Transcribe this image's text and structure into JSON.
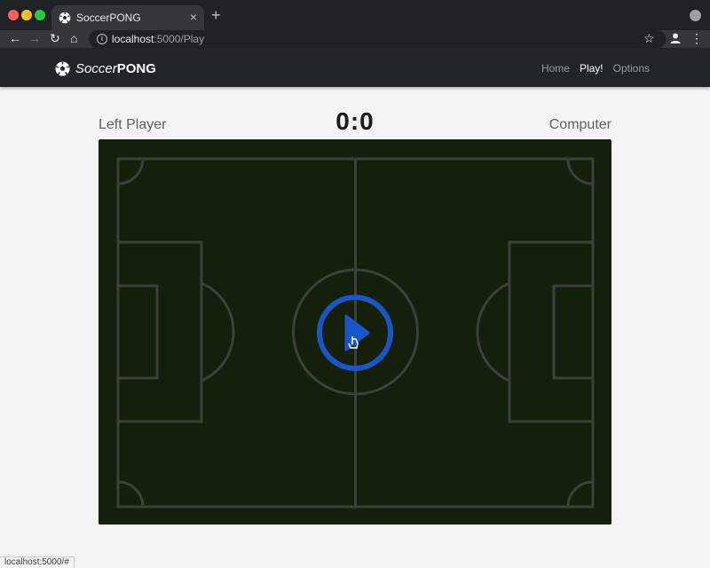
{
  "browser": {
    "tab_title": "SoccerPONG",
    "new_tab_symbol": "+",
    "url_host": "localhost",
    "url_path": ":5000/Play",
    "status_url": "localhost:5000/#"
  },
  "site": {
    "brand_soccer": "Soccer",
    "brand_pong": "PONG",
    "nav": [
      {
        "label": "Home",
        "active": false
      },
      {
        "label": "Play!",
        "active": true
      },
      {
        "label": "Options",
        "active": false
      }
    ]
  },
  "game": {
    "left_player": "Left Player",
    "right_player": "Computer",
    "score": "0:0",
    "play_button_color": "#1a56c8",
    "field_color": "#141f0c",
    "line_color": "#3d3f3d"
  },
  "icons": {
    "tab_favicon": "soccer-ball-icon",
    "back": "arrow-left-icon",
    "forward": "arrow-right-icon",
    "reload": "reload-icon",
    "home": "home-icon",
    "site_info": "info-icon",
    "bookmark": "star-icon",
    "profile": "person-icon",
    "menu": "kebab-icon",
    "play": "play-icon"
  }
}
